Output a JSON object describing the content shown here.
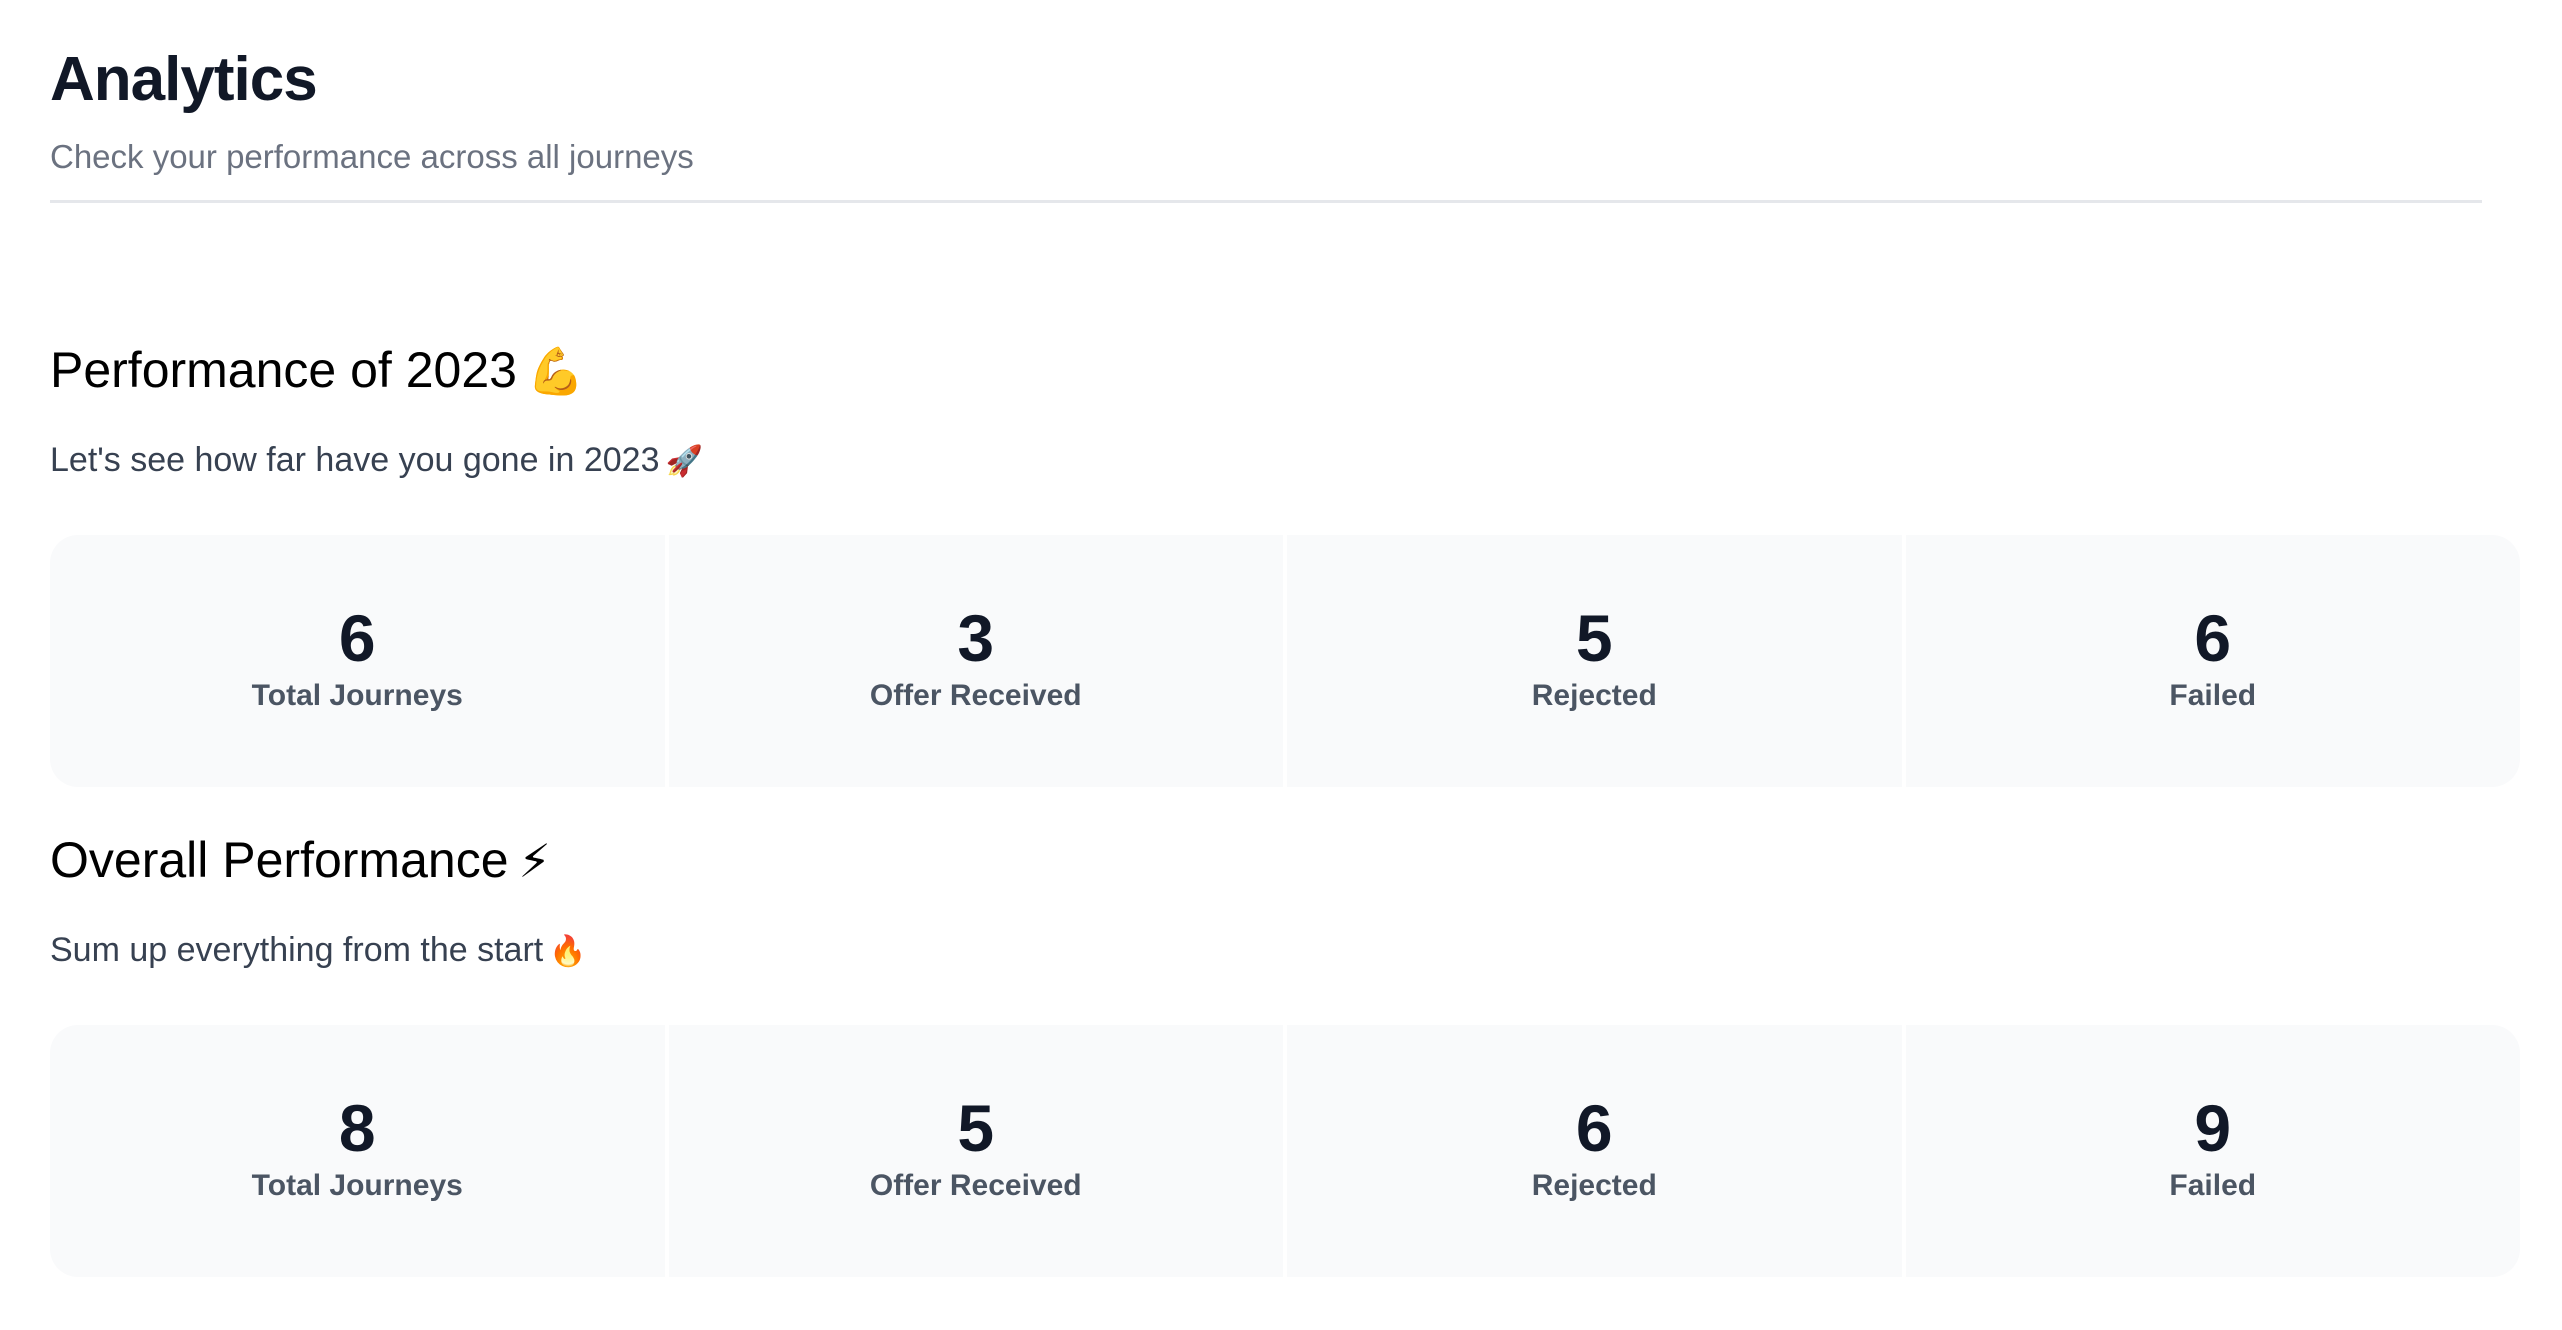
{
  "header": {
    "title": "Analytics",
    "subtitle": "Check your performance across all journeys"
  },
  "sections": [
    {
      "title": "Performance of 2023",
      "title_emoji": "💪",
      "description": "Let's see how far have you gone in 2023",
      "description_emoji": "🚀",
      "stats": [
        {
          "value": "6",
          "label": "Total Journeys"
        },
        {
          "value": "3",
          "label": "Offer Received"
        },
        {
          "value": "5",
          "label": "Rejected"
        },
        {
          "value": "6",
          "label": "Failed"
        }
      ]
    },
    {
      "title": "Overall Performance",
      "title_emoji": "⚡",
      "description": "Sum up everything from the start",
      "description_emoji": "🔥",
      "stats": [
        {
          "value": "8",
          "label": "Total Journeys"
        },
        {
          "value": "5",
          "label": "Offer Received"
        },
        {
          "value": "6",
          "label": "Rejected"
        },
        {
          "value": "9",
          "label": "Failed"
        }
      ]
    }
  ]
}
